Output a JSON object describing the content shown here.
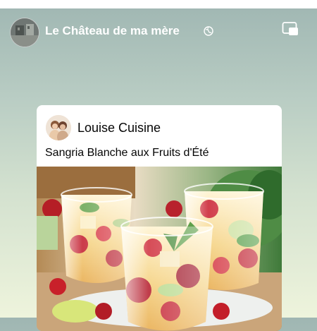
{
  "header": {
    "page_name": "Le Château de ma mère",
    "globe_icon": "globe-icon",
    "pip_icon": "picture-in-picture-icon"
  },
  "post": {
    "author": "Louise Cuisine",
    "caption": "Sangria Blanche aux Fruits d'Été",
    "image_icon": "sangria-glasses-photo"
  },
  "colors": {
    "header_text": "#ffffff",
    "card_background": "#ffffff",
    "background_top": "#9fb6b2",
    "background_bottom": "#eef4dc"
  }
}
